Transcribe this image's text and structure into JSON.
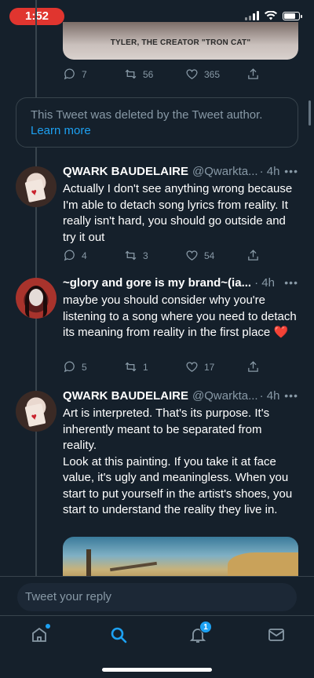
{
  "status_bar": {
    "time": "1:52"
  },
  "top_tweet": {
    "media_caption": "TYLER, THE CREATOR \"TRON CAT\"",
    "stats": {
      "replies": "7",
      "retweets": "56",
      "likes": "365"
    }
  },
  "deleted_notice": {
    "text": "This Tweet was deleted by the Tweet author.",
    "link": "Learn more"
  },
  "tweets": [
    {
      "name": "QWARK BAUDELAIRE",
      "handle": "@Qwarkta...",
      "time": "· 4h",
      "body": [
        "Actually I don't see anything wrong because I'm able to detach song lyrics from reality. It really isn't hard, you should go outside and try it out"
      ],
      "stats": {
        "replies": "4",
        "retweets": "3",
        "likes": "54"
      }
    },
    {
      "name": "~glory and gore is my brand~(ia...",
      "handle": "",
      "time": "· 4h",
      "body": [
        "maybe you should consider why you're listening to a song where you need to detach its meaning from reality  in the first place"
      ],
      "emoji": "❤️",
      "stats": {
        "replies": "5",
        "retweets": "1",
        "likes": "17"
      }
    },
    {
      "name": "QWARK BAUDELAIRE",
      "handle": "@Qwarkta...",
      "time": "· 4h",
      "body": [
        "Art is interpreted. That's its purpose. It's inherently meant to be separated from reality.",
        "Look at this painting. If you take it at face value, it's ugly and meaningless. When you start to put yourself in the artist's shoes, you start to understand the reality they live in."
      ]
    }
  ],
  "reply_bar": {
    "placeholder": "Tweet your reply"
  },
  "tab_bar": {
    "items": [
      "home-icon",
      "search-icon",
      "notifications-icon",
      "messages-icon"
    ],
    "notification_count": "1",
    "active": "search"
  },
  "colors": {
    "background": "#15202b",
    "accent": "#1da1f2",
    "muted": "#8899a6",
    "divider": "#38444d",
    "heart": "#e0245e"
  }
}
